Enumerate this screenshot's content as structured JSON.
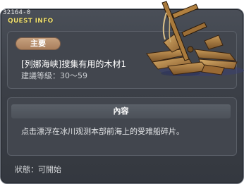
{
  "header": {
    "quest_id": "32164-0",
    "section_label": "QUEST INFO"
  },
  "quest": {
    "badge": "主要",
    "title": "[列娜海峡]搜集有用的木材1",
    "level": "建議等級：30～59",
    "illustration_icon": "shipwreck-icon"
  },
  "content": {
    "header": "內容",
    "description": "点击漂浮在冰川观测本部前海上的受难船碎片。"
  },
  "status": {
    "text": "狀態：可開始"
  },
  "colors": {
    "panel_bg": "#3c4048",
    "badge_bg": "#b48a66",
    "section_title": "#f0e070",
    "text": "#ffffff"
  }
}
